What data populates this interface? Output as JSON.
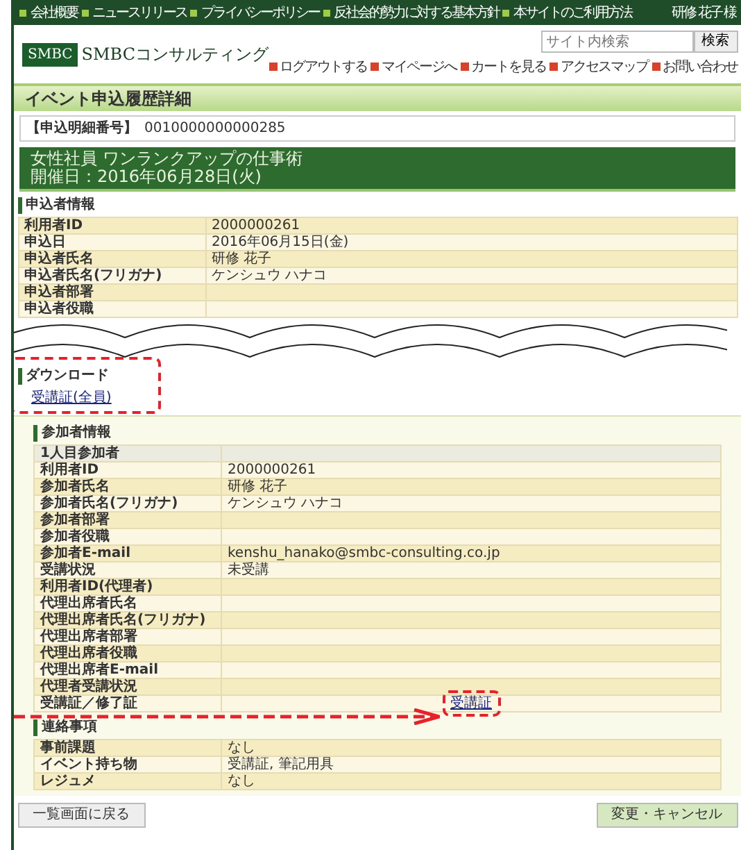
{
  "top_nav": {
    "links": [
      "会社概要",
      "ニュースリリース",
      "プライバシーポリシー",
      "反社会的勢力に対する基本方針",
      "本サイトのご利用方法"
    ],
    "user": "研修 花子 様"
  },
  "header": {
    "logo_badge": "SMBC",
    "logo_text": "SMBCコンサルティング",
    "search": {
      "placeholder": "サイト内検索",
      "button": "検索"
    },
    "links": [
      "ログアウトする",
      "マイページへ",
      "カートを見る",
      "アクセスマップ",
      "お問い合わせ"
    ]
  },
  "page_title": "イベント申込履歴詳細",
  "application_number": {
    "label": "【申込明細番号】",
    "value": "0010000000000285"
  },
  "event": {
    "title": "女性社員 ワンランクアップの仕事術",
    "date": "開催日：2016年06月28日(火)"
  },
  "applicant": {
    "heading": "申込者情報",
    "rows": [
      {
        "label": "利用者ID",
        "value": "2000000261"
      },
      {
        "label": "申込日",
        "value": "2016年06月15日(金)"
      },
      {
        "label": "申込者氏名",
        "value": "研修 花子"
      },
      {
        "label": "申込者氏名(フリガナ)",
        "value": "ケンシュウ ハナコ"
      },
      {
        "label": "申込者部署"
      },
      {
        "label": "申込者役職"
      }
    ]
  },
  "download": {
    "heading": "ダウンロード",
    "link": "受講証(全員)",
    "highlighted": true
  },
  "participants": {
    "heading": "参加者情報",
    "rows": [
      {
        "kind": "subheading",
        "label": "1人目参加者"
      },
      {
        "kind": "text",
        "label": "利用者ID",
        "value": "2000000261"
      },
      {
        "kind": "text",
        "label": "参加者氏名",
        "value": "研修 花子"
      },
      {
        "kind": "text",
        "label": "参加者氏名(フリガナ)",
        "value": "ケンシュウ ハナコ"
      },
      {
        "kind": "text",
        "label": "参加者部署"
      },
      {
        "kind": "text",
        "label": "参加者役職"
      },
      {
        "kind": "text",
        "label": "参加者E-mail",
        "value": "kenshu_hanako@smbc-consulting.co.jp"
      },
      {
        "kind": "text",
        "label": "受講状況",
        "value": "未受講"
      },
      {
        "kind": "text",
        "label": "利用者ID(代理者)"
      },
      {
        "kind": "text",
        "label": "代理出席者氏名"
      },
      {
        "kind": "text",
        "label": "代理出席者氏名(フリガナ)"
      },
      {
        "kind": "text",
        "label": "代理出席者部署"
      },
      {
        "kind": "text",
        "label": "代理出席者役職"
      },
      {
        "kind": "text",
        "label": "代理出席者E-mail"
      },
      {
        "kind": "text",
        "label": "代理者受講状況"
      },
      {
        "kind": "link",
        "label": "受講証／修了証",
        "value": "受講証",
        "highlighted": true
      }
    ]
  },
  "notes": {
    "heading": "連絡事項",
    "rows": [
      {
        "label": "事前課題",
        "value": "なし"
      },
      {
        "label": "イベント持ち物",
        "value": "受講証, 筆記用具"
      },
      {
        "label": "レジュメ",
        "value": "なし"
      }
    ]
  },
  "buttons": [
    {
      "kind": "back",
      "label": "一覧画面に戻る"
    },
    {
      "kind": "primary",
      "label": "変更・キャンセル"
    }
  ]
}
